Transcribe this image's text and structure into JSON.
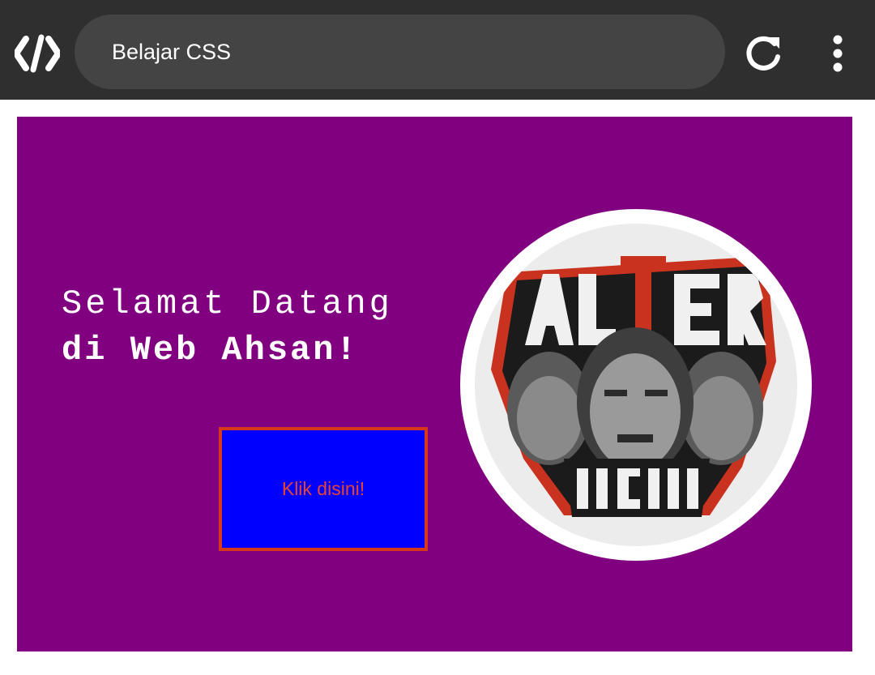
{
  "browser": {
    "title": "Belajar CSS",
    "icons": {
      "logo": "code-brackets-icon",
      "reload": "reload-icon",
      "menu": "more-vertical-icon"
    },
    "colors": {
      "bar": "#2f2f2f",
      "url_pill": "#444444"
    }
  },
  "hero": {
    "greeting_line1": "Selamat Datang",
    "greeting_line2": "di Web Ahsan!",
    "button_label": "Klik disini!",
    "avatar": {
      "logo_top": "ALTER",
      "logo_bottom": "NEGRO"
    },
    "colors": {
      "background": "#800080",
      "button_bg": "#0000ff",
      "button_border": "#d6381a",
      "button_text": "#e8452e"
    }
  }
}
